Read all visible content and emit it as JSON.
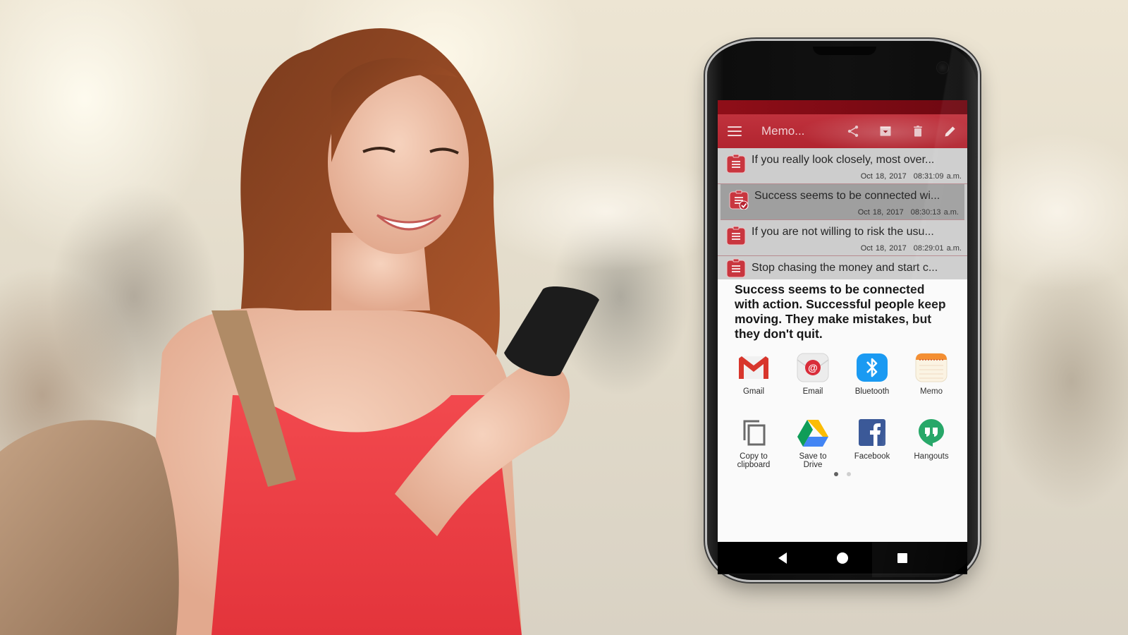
{
  "scene": {
    "description": "Woman smiling at smartphone beside phone mockup"
  },
  "app": {
    "title": "Memo...",
    "accent_color": "#b1242f",
    "status_color": "#7c0a14",
    "toolbar": {
      "menu_icon": "hamburger-menu-icon",
      "actions": [
        {
          "name": "share",
          "icon": "share-icon"
        },
        {
          "name": "archive",
          "icon": "archive-icon"
        },
        {
          "name": "delete",
          "icon": "trash-icon"
        },
        {
          "name": "edit",
          "icon": "pencil-icon"
        }
      ]
    },
    "memos": [
      {
        "title": "If you really look closely, most over...",
        "date": "Oct 18, 2017",
        "time": "08:31:09 a.m.",
        "selected": false
      },
      {
        "title": "Success seems to be connected wi...",
        "date": "Oct 18, 2017",
        "time": "08:30:13 a.m.",
        "selected": true
      },
      {
        "title": "If you are not willing to risk the usu...",
        "date": "Oct 18, 2017",
        "time": "08:29:01 a.m.",
        "selected": false
      },
      {
        "title": "Stop chasing the money and start c...",
        "date": "",
        "time": "",
        "selected": false
      }
    ],
    "preview_text": "Success seems to be connected with action. Successful people keep moving. They make mistakes, but they don't quit.",
    "share_targets": [
      {
        "label": "Gmail",
        "icon": "gmail-icon"
      },
      {
        "label": "Email",
        "icon": "email-icon"
      },
      {
        "label": "Bluetooth",
        "icon": "bluetooth-icon"
      },
      {
        "label": "Memo",
        "icon": "memo-notepad-icon"
      },
      {
        "label": "Copy to\nclipboard",
        "icon": "copy-icon"
      },
      {
        "label": "Save to\nDrive",
        "icon": "google-drive-icon"
      },
      {
        "label": "Facebook",
        "icon": "facebook-icon"
      },
      {
        "label": "Hangouts",
        "icon": "hangouts-icon"
      }
    ],
    "pager": {
      "pages": 2,
      "current": 1
    },
    "navbar": [
      "back",
      "home",
      "recents"
    ]
  }
}
